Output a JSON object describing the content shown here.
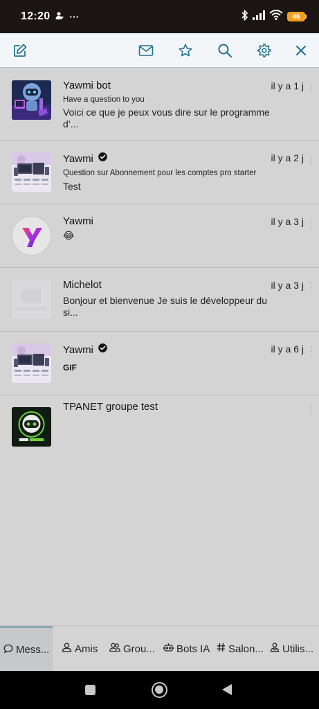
{
  "status_bar": {
    "time": "12:20",
    "more": "···",
    "battery": "46"
  },
  "toolbar": {
    "icons": [
      "compose-icon",
      "mail-icon",
      "star-icon",
      "search-icon",
      "gear-icon",
      "close-icon"
    ],
    "accent": "#1e6f8e"
  },
  "conversations": [
    {
      "name": "Yawmi bot",
      "verified": false,
      "time": "il y a 1 j",
      "subtitle": "Have a question to you",
      "message": "Voici ce que je peux vous dire sur le programme d’..."
    },
    {
      "name": "Yawmi",
      "verified": true,
      "time": "il y a 2 j",
      "subtitle": "Question sur Abonnement pour les comptes pro starter",
      "message": "Test"
    },
    {
      "name": "Yawmi",
      "verified": false,
      "time": "il y a 3 j",
      "subtitle": "",
      "message": "😂"
    },
    {
      "name": "Michelot",
      "verified": false,
      "time": "il y a 3 j",
      "subtitle": "",
      "message": "Bonjour et bienvenue Je suis le développeur du si..."
    },
    {
      "name": "Yawmi",
      "verified": true,
      "time": "il y a 6 j",
      "subtitle": "",
      "message": "GIF"
    },
    {
      "name": "TPANET groupe test",
      "verified": false,
      "time": "",
      "subtitle": "",
      "message": ""
    }
  ],
  "bottom_nav": {
    "tabs": [
      {
        "label": "Mess...",
        "icon": "chat-bubble-icon",
        "active": true
      },
      {
        "label": "Amis",
        "icon": "person-icon",
        "active": false
      },
      {
        "label": "Grou...",
        "icon": "group-icon",
        "active": false
      },
      {
        "label": "Bots IA",
        "icon": "robot-icon",
        "active": false
      },
      {
        "label": "Salon...",
        "icon": "hashtag-icon",
        "active": false
      },
      {
        "label": "Utilis...",
        "icon": "users-icon",
        "active": false
      }
    ]
  }
}
